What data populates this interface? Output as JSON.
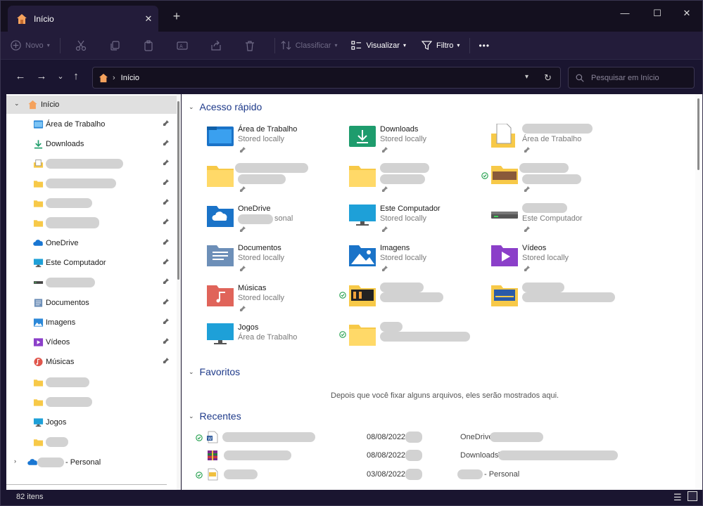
{
  "window": {
    "tab_title": "Início",
    "tab_close": "✕",
    "new_tab": "+",
    "controls": {
      "minimize": "—",
      "maximize": "☐",
      "close": "✕"
    }
  },
  "toolbar": {
    "new_label": "Novo",
    "sort_label": "Classificar",
    "view_label": "Visualizar",
    "filter_label": "Filtro",
    "more_label": "•••"
  },
  "address": {
    "crumb": "Início",
    "search_placeholder": "Pesquisar em Início"
  },
  "nav": {
    "home": "Início",
    "items": [
      {
        "label": "Área de Trabalho",
        "icon": "desktop-icon"
      },
      {
        "label": "Downloads",
        "icon": "downloads-icon"
      },
      {
        "label": "",
        "icon": "document-folder-icon"
      },
      {
        "label": "",
        "icon": "folder-icon"
      },
      {
        "label": "",
        "icon": "folder-icon"
      },
      {
        "label": "",
        "icon": "folder-icon"
      },
      {
        "label": "OneDrive",
        "icon": "onedrive-icon"
      },
      {
        "label": "Este Computador",
        "icon": "monitor-icon"
      },
      {
        "label": "",
        "icon": "drive-icon"
      },
      {
        "label": "Documentos",
        "icon": "documents-icon"
      },
      {
        "label": "Imagens",
        "icon": "pictures-icon"
      },
      {
        "label": "Vídeos",
        "icon": "videos-icon"
      },
      {
        "label": "Músicas",
        "icon": "music-icon"
      },
      {
        "label": "",
        "icon": "folder-icon"
      },
      {
        "label": "",
        "icon": "folder-icon"
      },
      {
        "label": "Jogos",
        "icon": "monitor-icon"
      },
      {
        "label": "",
        "icon": "folder-icon"
      },
      {
        "label": "- Personal",
        "icon": "onedrive-icon"
      }
    ]
  },
  "quick_access": {
    "title": "Acesso rápido",
    "tiles": [
      {
        "name": "Área de Trabalho",
        "sub": "Stored locally",
        "icon": "desktop-folder-icon"
      },
      {
        "name": "Downloads",
        "sub": "Stored locally",
        "icon": "downloads-folder-icon"
      },
      {
        "name": "",
        "sub": "Área de Trabalho",
        "icon": "document-folder-icon"
      },
      {
        "name": "",
        "sub": "",
        "icon": "folder-icon"
      },
      {
        "name": "",
        "sub": "",
        "icon": "folder-icon"
      },
      {
        "name": "",
        "sub": "",
        "icon": "photo-folder-icon"
      },
      {
        "name": "OneDrive",
        "sub": "sonal",
        "icon": "onedrive-folder-icon"
      },
      {
        "name": "Este Computador",
        "sub": "Stored locally",
        "icon": "monitor-icon"
      },
      {
        "name": "",
        "sub": "Este Computador",
        "icon": "drive-icon"
      },
      {
        "name": "Documentos",
        "sub": "Stored locally",
        "icon": "documents-folder-icon"
      },
      {
        "name": "Imagens",
        "sub": "Stored locally",
        "icon": "pictures-folder-icon"
      },
      {
        "name": "Vídeos",
        "sub": "Stored locally",
        "icon": "videos-folder-icon"
      },
      {
        "name": "Músicas",
        "sub": "Stored locally",
        "icon": "music-folder-icon"
      },
      {
        "name": "",
        "sub": "",
        "icon": "photo-folder-icon"
      },
      {
        "name": "",
        "sub": "",
        "icon": "photo-folder-icon"
      },
      {
        "name": "Jogos",
        "sub": "Área de Trabalho",
        "icon": "monitor-icon"
      },
      {
        "name": "",
        "sub": "",
        "icon": "folder-icon"
      }
    ]
  },
  "favorites": {
    "title": "Favoritos",
    "empty_message": "Depois que você fixar alguns arquivos, eles serão mostrados aqui."
  },
  "recent": {
    "title": "Recentes",
    "rows": [
      {
        "date": "08/08/2022",
        "location": "OneDrive",
        "icon": "word-file-icon"
      },
      {
        "date": "08/08/2022",
        "location": "Downloads\\",
        "icon": "archive-file-icon"
      },
      {
        "date": "03/08/2022",
        "location": "- Personal",
        "icon": "pdf-file-icon"
      }
    ]
  },
  "status": {
    "item_count": "82 itens"
  },
  "colors": {
    "accent": "#1e3a8a",
    "folder": "#f7c948",
    "chrome_dark": "#1a1530"
  }
}
